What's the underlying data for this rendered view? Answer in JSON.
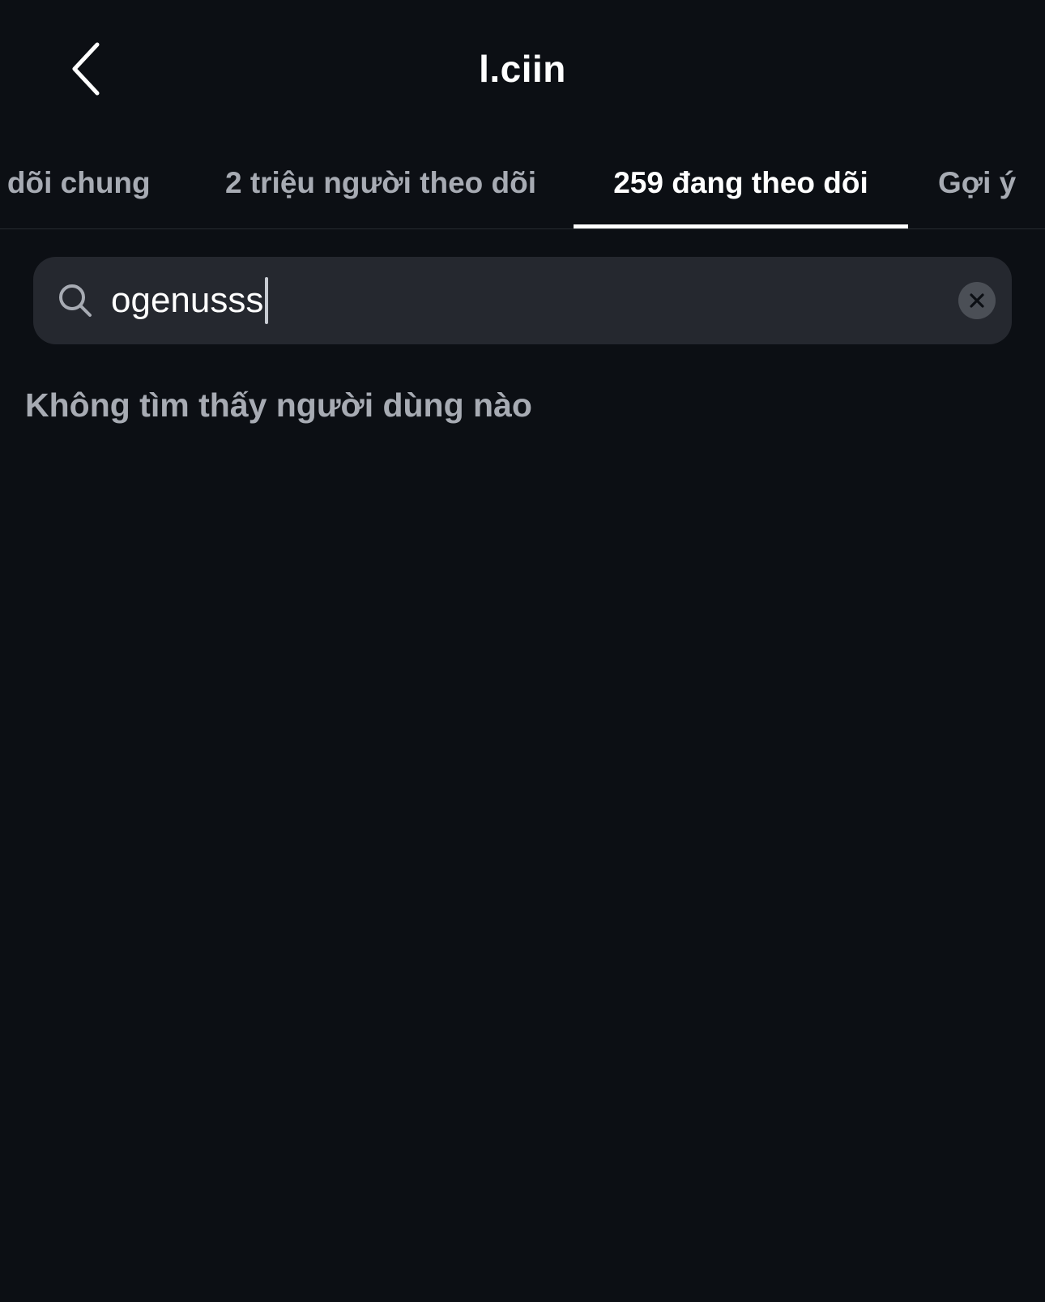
{
  "header": {
    "title": "l.ciin",
    "back_icon": "chevron-left-icon"
  },
  "tabs": [
    {
      "label": "o dõi chung",
      "active": false
    },
    {
      "label": "2 triệu người theo dõi",
      "active": false
    },
    {
      "label": "259 đang theo dõi",
      "active": true
    },
    {
      "label": "Gợi ý",
      "active": false
    }
  ],
  "search": {
    "value": "ogenusss",
    "search_icon": "search-icon",
    "clear_icon": "clear-icon"
  },
  "results": {
    "empty_message": "Không tìm thấy người dùng nào"
  },
  "colors": {
    "background": "#0c0f14",
    "search_bg": "#25282f",
    "muted_text": "#a7abb3",
    "active_text": "#ffffff"
  }
}
